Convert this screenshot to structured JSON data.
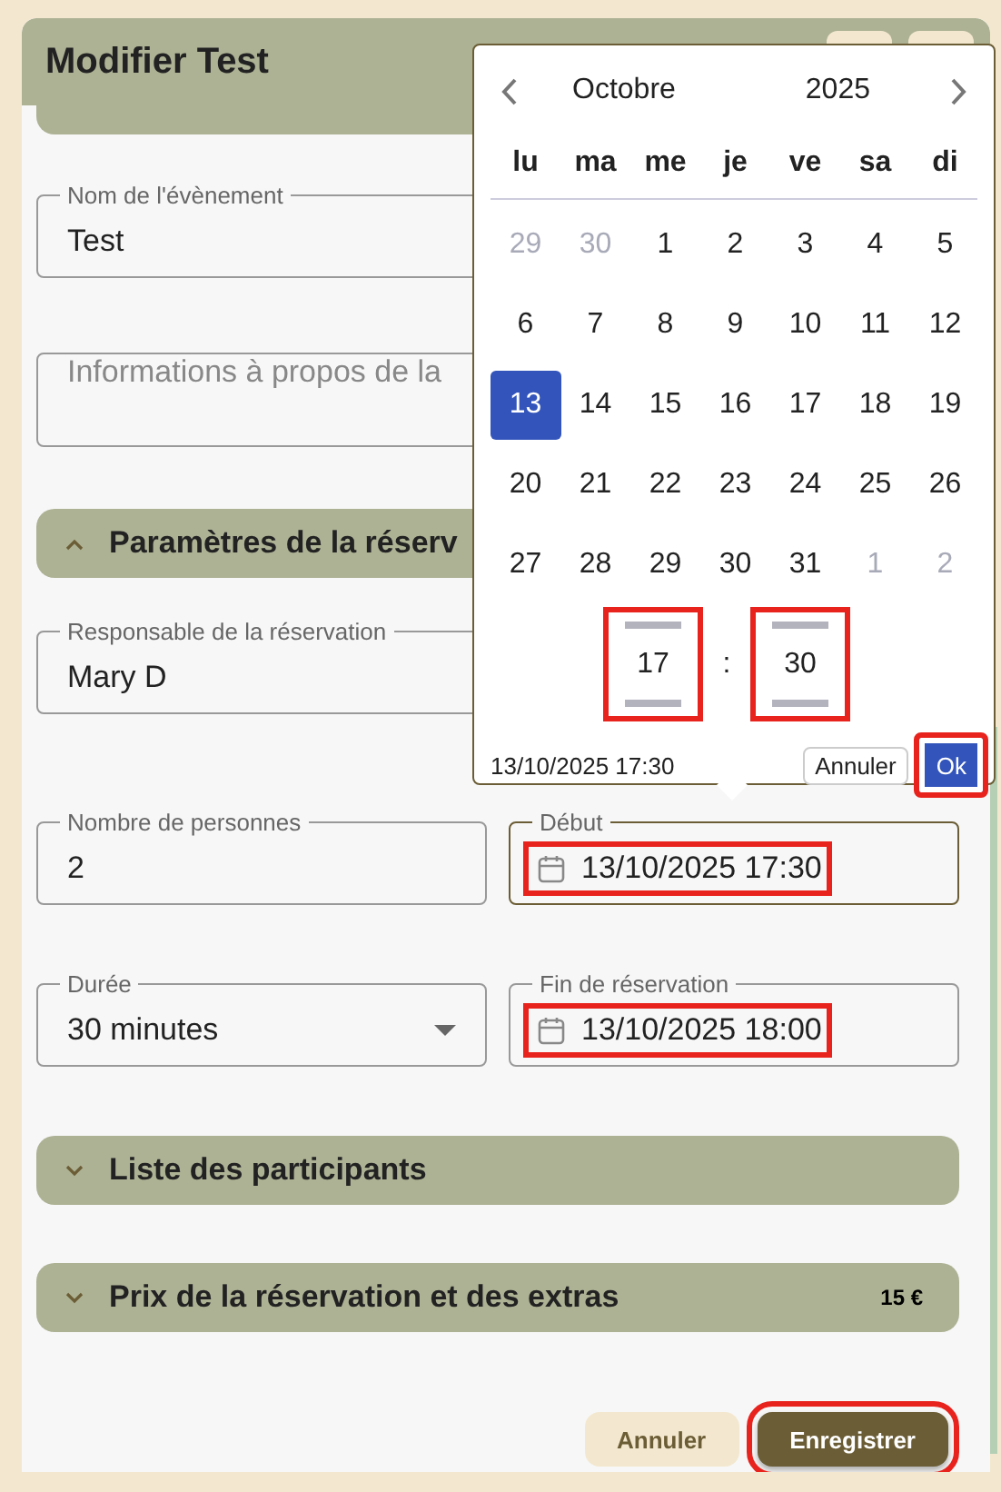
{
  "page_title": "Modifier Test",
  "event_name": {
    "label": "Nom de l'évènement",
    "value": "Test"
  },
  "description": {
    "placeholder": "Informations à propos de la"
  },
  "section_params": {
    "title": "Paramètres de la réserv",
    "expanded": true
  },
  "manager": {
    "label": "Responsable de la réservation",
    "value": "Mary D"
  },
  "people": {
    "label": "Nombre de personnes",
    "value": "2"
  },
  "start": {
    "label": "Début",
    "value": "13/10/2025 17:30",
    "focused": true,
    "highlighted": true
  },
  "duration": {
    "label": "Durée",
    "value": "30 minutes"
  },
  "end": {
    "label": "Fin de réservation",
    "value": "13/10/2025 18:00",
    "focused": false,
    "highlighted": true
  },
  "collapsed_sections": [
    {
      "title": "Liste des participants",
      "expanded": false
    },
    {
      "title": "Prix de la réservation et des extras",
      "expanded": false,
      "amount": "15 €"
    }
  ],
  "footer_buttons": [
    {
      "label": "Annuler",
      "kind": "secondary",
      "highlighted": false
    },
    {
      "label": "Enregistrer",
      "kind": "primary",
      "highlighted": true
    }
  ],
  "date_picker": {
    "month": "Octobre",
    "year": "2025",
    "weekdays": [
      "lu",
      "ma",
      "me",
      "je",
      "ve",
      "sa",
      "di"
    ],
    "weeks": [
      [
        {
          "day": "29",
          "outside": true,
          "selected": false
        },
        {
          "day": "30",
          "outside": true,
          "selected": false
        },
        {
          "day": "1",
          "outside": false,
          "selected": false
        },
        {
          "day": "2",
          "outside": false,
          "selected": false
        },
        {
          "day": "3",
          "outside": false,
          "selected": false
        },
        {
          "day": "4",
          "outside": false,
          "selected": false
        },
        {
          "day": "5",
          "outside": false,
          "selected": false
        }
      ],
      [
        {
          "day": "6",
          "outside": false,
          "selected": false
        },
        {
          "day": "7",
          "outside": false,
          "selected": false
        },
        {
          "day": "8",
          "outside": false,
          "selected": false
        },
        {
          "day": "9",
          "outside": false,
          "selected": false
        },
        {
          "day": "10",
          "outside": false,
          "selected": false
        },
        {
          "day": "11",
          "outside": false,
          "selected": false
        },
        {
          "day": "12",
          "outside": false,
          "selected": false
        }
      ],
      [
        {
          "day": "13",
          "outside": false,
          "selected": true
        },
        {
          "day": "14",
          "outside": false,
          "selected": false
        },
        {
          "day": "15",
          "outside": false,
          "selected": false
        },
        {
          "day": "16",
          "outside": false,
          "selected": false
        },
        {
          "day": "17",
          "outside": false,
          "selected": false
        },
        {
          "day": "18",
          "outside": false,
          "selected": false
        },
        {
          "day": "19",
          "outside": false,
          "selected": false
        }
      ],
      [
        {
          "day": "20",
          "outside": false,
          "selected": false
        },
        {
          "day": "21",
          "outside": false,
          "selected": false
        },
        {
          "day": "22",
          "outside": false,
          "selected": false
        },
        {
          "day": "23",
          "outside": false,
          "selected": false
        },
        {
          "day": "24",
          "outside": false,
          "selected": false
        },
        {
          "day": "25",
          "outside": false,
          "selected": false
        },
        {
          "day": "26",
          "outside": false,
          "selected": false
        }
      ],
      [
        {
          "day": "27",
          "outside": false,
          "selected": false
        },
        {
          "day": "28",
          "outside": false,
          "selected": false
        },
        {
          "day": "29",
          "outside": false,
          "selected": false
        },
        {
          "day": "30",
          "outside": false,
          "selected": false
        },
        {
          "day": "31",
          "outside": false,
          "selected": false
        },
        {
          "day": "1",
          "outside": true,
          "selected": false
        },
        {
          "day": "2",
          "outside": true,
          "selected": false
        }
      ]
    ],
    "hour": {
      "value": "17",
      "highlighted": true
    },
    "separator": ":",
    "minute": {
      "value": "30",
      "highlighted": true
    },
    "selected_text": "13/10/2025 17:30",
    "buttons": [
      {
        "label": "Annuler",
        "kind": "secondary",
        "highlighted": false
      },
      {
        "label": "Ok",
        "kind": "primary",
        "highlighted": true
      }
    ]
  }
}
